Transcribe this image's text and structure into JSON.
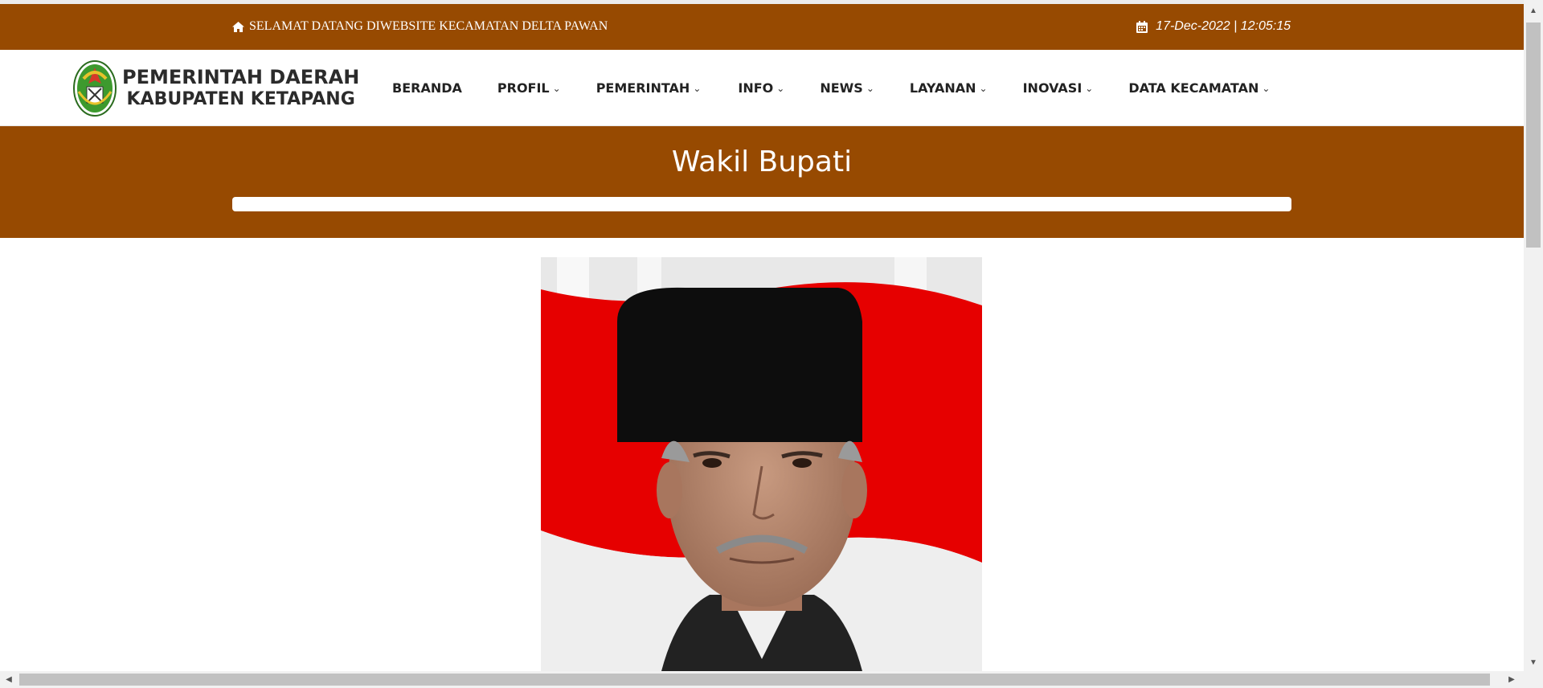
{
  "topbar": {
    "welcome_text": "SELAMAT DATANG DIWEBSITE KECAMATAN DELTA PAWAN",
    "welcome_icon": "home-icon",
    "datetime": "17-Dec-2022 | 12:05:15",
    "datetime_icon": "calendar-icon",
    "background_color": "#974a01"
  },
  "logo": {
    "line1": "PEMERINTAH DAERAH",
    "line2": "KABUPATEN KETAPANG"
  },
  "nav": {
    "items": [
      {
        "label": "BERANDA",
        "has_dropdown": false
      },
      {
        "label": "PROFIL",
        "has_dropdown": true
      },
      {
        "label": "PEMERINTAH",
        "has_dropdown": true
      },
      {
        "label": "INFO",
        "has_dropdown": true
      },
      {
        "label": "NEWS",
        "has_dropdown": true
      },
      {
        "label": "LAYANAN",
        "has_dropdown": true
      },
      {
        "label": "INOVASI",
        "has_dropdown": true
      },
      {
        "label": "DATA KECAMATAN",
        "has_dropdown": true
      }
    ]
  },
  "banner": {
    "title": "Wakil Bupati"
  },
  "colors": {
    "brand_brown": "#974a01",
    "white": "#ffffff"
  }
}
